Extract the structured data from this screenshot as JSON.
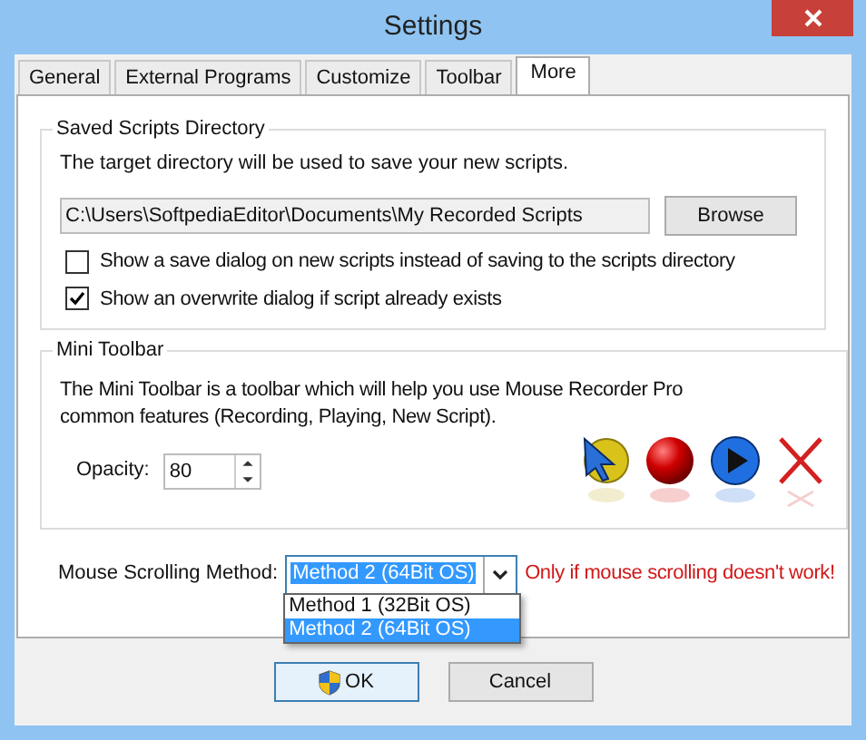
{
  "window": {
    "title": "Settings"
  },
  "tabs": [
    {
      "label": "General",
      "selected": false
    },
    {
      "label": "External Programs",
      "selected": false
    },
    {
      "label": "Customize",
      "selected": false
    },
    {
      "label": "Toolbar",
      "selected": false
    },
    {
      "label": "More",
      "selected": true
    }
  ],
  "saved_scripts": {
    "title": "Saved Scripts Directory",
    "description": "The target directory will be used to save your new scripts.",
    "path": "C:\\Users\\SoftpediaEditor\\Documents\\My Recorded Scripts",
    "browse_button": "Browse",
    "options": [
      {
        "label": "Show a save dialog on new scripts instead of saving to the scripts directory",
        "checked": false
      },
      {
        "label": "Show an overwrite dialog if script already exists",
        "checked": true
      }
    ]
  },
  "mini_toolbar": {
    "title": "Mini Toolbar",
    "description": "The Mini Toolbar is a toolbar which will help you use Mouse Recorder Pro common features (Recording, Playing, New Script).",
    "opacity_label": "Opacity:",
    "opacity_value": "80"
  },
  "scrolling": {
    "label": "Mouse Scrolling Method:",
    "value": "Method 2 (64Bit OS)",
    "note": "Only if mouse scrolling doesn't work!",
    "options": [
      {
        "label": "Method 1 (32Bit OS)",
        "selected": false
      },
      {
        "label": "Method 2 (64Bit OS)",
        "selected": true
      }
    ]
  },
  "buttons": [
    {
      "label": "OK",
      "kind": "elevated"
    },
    {
      "label": "Cancel",
      "kind": "plain"
    }
  ]
}
